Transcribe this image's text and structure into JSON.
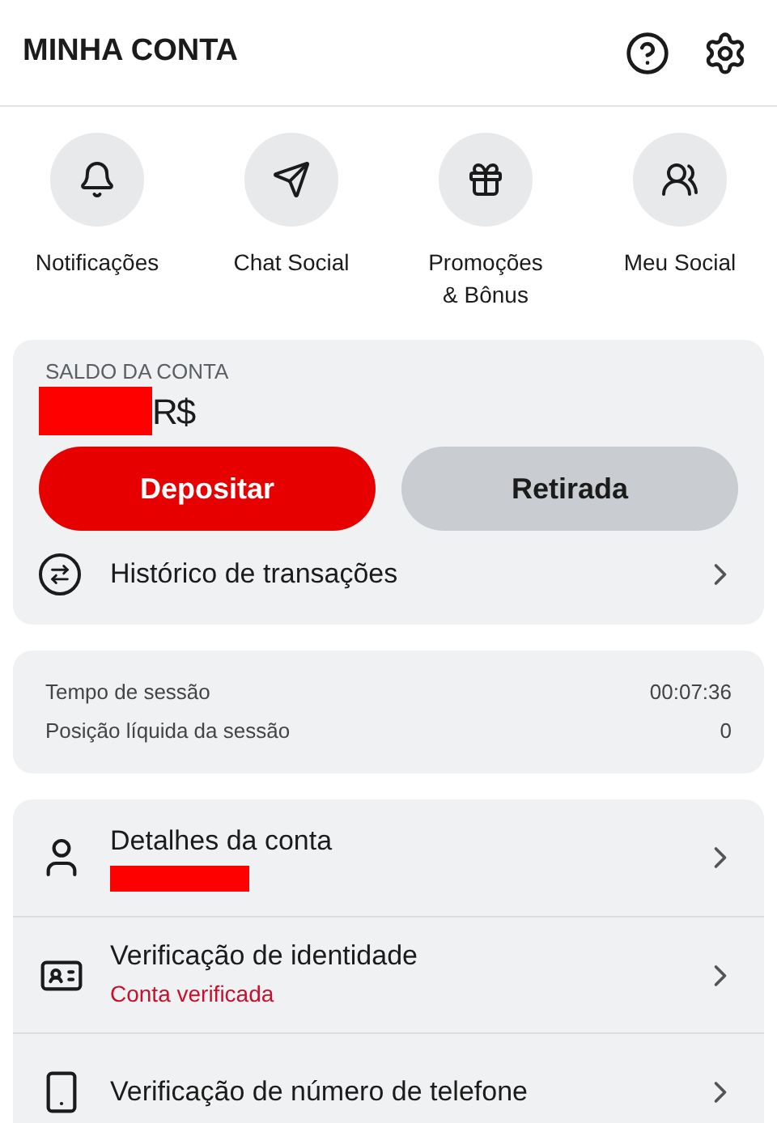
{
  "header": {
    "title": "MINHA CONTA"
  },
  "shortcuts": [
    {
      "label": "Notificações"
    },
    {
      "label": "Chat Social"
    },
    {
      "label": "Promoções\n& Bônus"
    },
    {
      "label": "Meu Social"
    }
  ],
  "balance": {
    "label": "SALDO DA CONTA",
    "currency": "R$",
    "deposit": "Depositar",
    "withdraw": "Retirada",
    "history": "Histórico de transações"
  },
  "session": [
    {
      "label": "Tempo de sessão",
      "value": "00:07:36"
    },
    {
      "label": "Posição líquida da sessão",
      "value": "0"
    }
  ],
  "account_rows": [
    {
      "title": "Detalhes da conta",
      "redacted": true
    },
    {
      "title": "Verificação de identidade",
      "subtitle": "Conta verificada",
      "redacted": false
    },
    {
      "title": "Verificação de número de telefone",
      "redacted": false
    }
  ]
}
